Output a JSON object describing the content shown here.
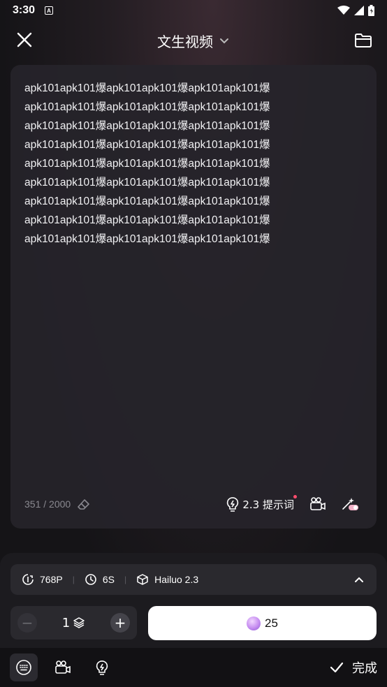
{
  "status_bar": {
    "time": "3:30",
    "badge": "A"
  },
  "header": {
    "title": "文生视频"
  },
  "editor": {
    "content": "apk101apk101爆apk101apk101爆apk101apk101爆\napk101apk101爆apk101apk101爆apk101apk101爆\napk101apk101爆apk101apk101爆apk101apk101爆\napk101apk101爆apk101apk101爆apk101apk101爆\napk101apk101爆apk101apk101爆apk101apk101爆\napk101apk101爆apk101apk101爆apk101apk101爆\napk101apk101爆apk101apk101爆apk101apk101爆\napk101apk101爆apk101apk101爆apk101apk101爆\napk101apk101爆apk101apk101爆apk101apk101爆",
    "char_count": "351 / 2000",
    "prompt_label": "2.3 提示词"
  },
  "settings": {
    "resolution": "768P",
    "duration": "6S",
    "model": "Hailuo 2.3"
  },
  "quantity": {
    "value": "1"
  },
  "generate": {
    "cost": "25"
  },
  "bottom": {
    "done_label": "完成"
  },
  "icons": [
    "close-icon",
    "folder-icon",
    "chevron-down-icon",
    "eraser-icon",
    "bulb-icon",
    "camera-icon",
    "magic-toggle-icon",
    "resolution-icon",
    "clock-icon",
    "cube-icon",
    "chevron-up-icon",
    "layers-icon",
    "keyboard-icon",
    "check-icon"
  ],
  "colors": {
    "accent_dot": "#ff4d6d",
    "primary_button": "#ffffff"
  }
}
